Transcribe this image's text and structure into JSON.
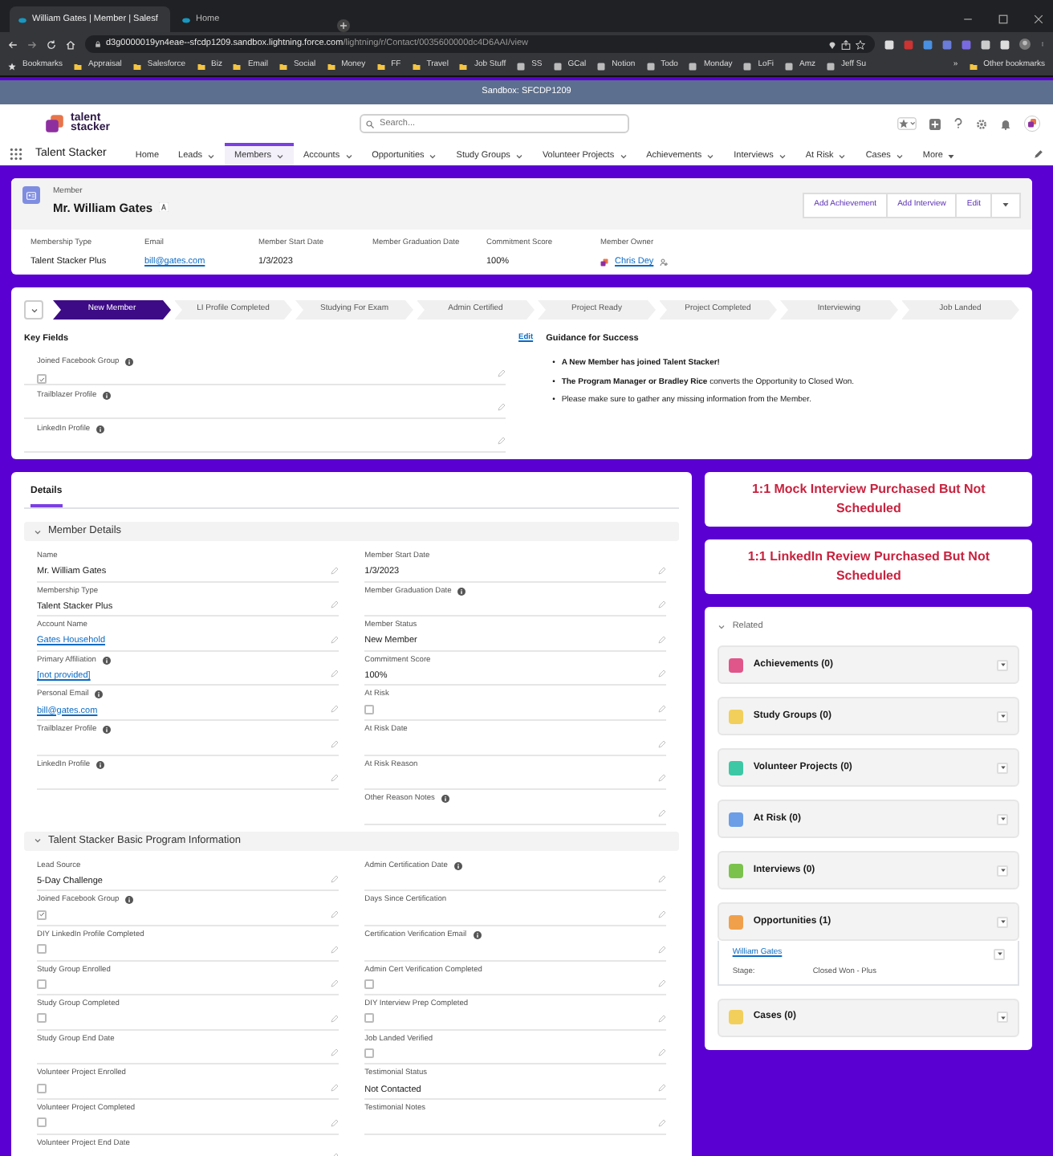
{
  "browser": {
    "tabs": [
      {
        "label": "William Gates | Member | Salesf",
        "selected": true
      },
      {
        "label": "Home",
        "selected": false
      }
    ],
    "url_host": "d3g0000019yn4eae--sfcdp1209.sandbox.lightning.force.com",
    "url_path": "/lightning/r/Contact/0035600000dc4D6AAI/view",
    "bookmarks": [
      {
        "label": "Bookmarks",
        "kind": "star"
      },
      {
        "label": "Appraisal",
        "kind": "folder"
      },
      {
        "label": "Salesforce",
        "kind": "folder"
      },
      {
        "label": "Biz",
        "kind": "folder"
      },
      {
        "label": "Email",
        "kind": "folder"
      },
      {
        "label": "Social",
        "kind": "folder"
      },
      {
        "label": "Money",
        "kind": "folder"
      },
      {
        "label": "FF",
        "kind": "folder"
      },
      {
        "label": "Travel",
        "kind": "folder"
      },
      {
        "label": "Job Stuff",
        "kind": "folder"
      },
      {
        "label": "SS",
        "kind": "site"
      },
      {
        "label": "GCal",
        "kind": "site"
      },
      {
        "label": "Notion",
        "kind": "site"
      },
      {
        "label": "Todo",
        "kind": "site"
      },
      {
        "label": "Monday",
        "kind": "site"
      },
      {
        "label": "LoFi",
        "kind": "site"
      },
      {
        "label": "Amz",
        "kind": "site"
      },
      {
        "label": "Jeff Su",
        "kind": "site"
      }
    ],
    "bookmarks_overflow": "»",
    "other_bookmarks": "Other bookmarks"
  },
  "sandbox_banner": "Sandbox: SFCDP1209",
  "header": {
    "logo_lines": [
      "talent",
      "stacker"
    ],
    "search_placeholder": "Search..."
  },
  "nav": {
    "app_name": "Talent Stacker",
    "items": [
      {
        "label": "Home",
        "dropdown": false,
        "selected": false
      },
      {
        "label": "Leads",
        "dropdown": true,
        "selected": false
      },
      {
        "label": "Members",
        "dropdown": true,
        "selected": true
      },
      {
        "label": "Accounts",
        "dropdown": true,
        "selected": false
      },
      {
        "label": "Opportunities",
        "dropdown": true,
        "selected": false
      },
      {
        "label": "Study Groups",
        "dropdown": true,
        "selected": false
      },
      {
        "label": "Volunteer Projects",
        "dropdown": true,
        "selected": false
      },
      {
        "label": "Achievements",
        "dropdown": true,
        "selected": false
      },
      {
        "label": "Interviews",
        "dropdown": true,
        "selected": false
      },
      {
        "label": "At Risk",
        "dropdown": true,
        "selected": false
      },
      {
        "label": "Cases",
        "dropdown": true,
        "selected": false
      }
    ],
    "more": "More"
  },
  "record": {
    "object": "Member",
    "name": "Mr. William Gates",
    "actions": [
      "Add Achievement",
      "Add Interview",
      "Edit"
    ],
    "highlights": [
      {
        "label": "Membership Type",
        "value": "Talent Stacker Plus",
        "kind": "text"
      },
      {
        "label": "Email",
        "value": "bill@gates.com",
        "kind": "link"
      },
      {
        "label": "Member Start Date",
        "value": "1/3/2023",
        "kind": "text"
      },
      {
        "label": "Member Graduation Date"
      },
      {
        "label": "Commitment Score",
        "value": "100%",
        "kind": "text"
      },
      {
        "label": "Member Owner",
        "value": "Chris Dey",
        "kind": "owner"
      }
    ]
  },
  "path": {
    "steps": [
      {
        "label": "New Member",
        "selected": true
      },
      {
        "label": "LI Profile Completed",
        "selected": false
      },
      {
        "label": "Studying For Exam",
        "selected": false
      },
      {
        "label": "Admin Certified",
        "selected": false
      },
      {
        "label": "Project Ready",
        "selected": false
      },
      {
        "label": "Project Completed",
        "selected": false
      },
      {
        "label": "Interviewing",
        "selected": false
      },
      {
        "label": "Job Landed",
        "selected": false
      }
    ],
    "key_fields_title": "Key Fields",
    "edit": "Edit",
    "key_fields": [
      {
        "label": "Joined Facebook Group",
        "kind": "checkbox",
        "checked": true,
        "info": true
      },
      {
        "label": "Trailblazer Profile",
        "info": true
      },
      {
        "label": "LinkedIn Profile",
        "info": true
      }
    ],
    "bullet": "•",
    "guidance_title": "Guidance for Success",
    "guidance": [
      "**A New Member has joined Talent Stacker!**",
      "**The Program Manager or Bradley Rice** converts the Opportunity to Closed Won.",
      "Please make sure to gather any missing information from the Member."
    ]
  },
  "details": {
    "tab": "Details",
    "sections": [
      {
        "title": "Member Details",
        "expanded": true,
        "left": [
          {
            "label": "Name",
            "value": "Mr. William Gates",
            "kind": "text"
          },
          {
            "label": "Membership Type",
            "value": "Talent Stacker Plus",
            "kind": "text"
          },
          {
            "label": "Account Name",
            "value": "Gates Household",
            "kind": "link"
          },
          {
            "label": "Primary Affiliation",
            "value": "[not provided]",
            "kind": "link",
            "info": true
          },
          {
            "label": "Personal Email",
            "value": "bill@gates.com",
            "kind": "link",
            "info": true
          },
          {
            "label": "Trailblazer Profile",
            "info": true
          },
          {
            "label": "LinkedIn Profile",
            "info": true
          }
        ],
        "right": [
          {
            "label": "Member Start Date",
            "value": "1/3/2023",
            "kind": "text"
          },
          {
            "label": "Member Graduation Date",
            "info": true
          },
          {
            "label": "Member Status",
            "value": "New Member",
            "kind": "text"
          },
          {
            "label": "Commitment Score",
            "value": "100%",
            "kind": "text"
          },
          {
            "label": "At Risk",
            "kind": "checkbox",
            "checked": false
          },
          {
            "label": "At Risk Date"
          },
          {
            "label": "At Risk Reason"
          },
          {
            "label": "Other Reason Notes",
            "info": true
          }
        ]
      },
      {
        "title": "Talent Stacker Basic Program Information",
        "expanded": true,
        "left": [
          {
            "label": "Lead Source",
            "value": "5-Day Challenge",
            "kind": "text"
          },
          {
            "label": "Joined Facebook Group",
            "kind": "checkbox",
            "checked": true,
            "info": true
          },
          {
            "label": "DIY LinkedIn Profile Completed",
            "kind": "checkbox",
            "checked": false
          },
          {
            "label": "Study Group Enrolled",
            "kind": "checkbox",
            "checked": false
          },
          {
            "label": "Study Group Completed",
            "kind": "checkbox",
            "checked": false
          },
          {
            "label": "Study Group End Date"
          },
          {
            "label": "Volunteer Project Enrolled",
            "kind": "checkbox",
            "checked": false
          },
          {
            "label": "Volunteer Project Completed",
            "kind": "checkbox",
            "checked": false
          },
          {
            "label": "Volunteer Project End Date"
          }
        ],
        "right": [
          {
            "label": "Admin Certification Date",
            "info": true
          },
          {
            "label": "Days Since Certification"
          },
          {
            "label": "Certification Verification Email",
            "info": true
          },
          {
            "label": "Admin Cert Verification Completed",
            "kind": "checkbox",
            "checked": false
          },
          {
            "label": "DIY Interview Prep Completed",
            "kind": "checkbox",
            "checked": false
          },
          {
            "label": "Job Landed Verified",
            "kind": "checkbox",
            "checked": false
          },
          {
            "label": "Testimonial Status",
            "value": "Not Contacted",
            "kind": "text"
          },
          {
            "label": "Testimonial Notes"
          }
        ]
      }
    ]
  },
  "alerts": [
    "1:1 Mock Interview Purchased But Not Scheduled",
    "1:1 LinkedIn Review Purchased But Not Scheduled"
  ],
  "related": {
    "title": "Related",
    "expanded": true,
    "lists": [
      {
        "label": "Achievements (0)",
        "color": "#e0568a"
      },
      {
        "label": "Study Groups (0)",
        "color": "#f2cf5b"
      },
      {
        "label": "Volunteer Projects (0)",
        "color": "#3cc8a5"
      },
      {
        "label": "At Risk (0)",
        "color": "#6b9ee6"
      },
      {
        "label": "Interviews (0)",
        "color": "#7bc24c"
      },
      {
        "label": "Opportunities (1)",
        "color": "#f0a04b",
        "records": [
          {
            "name": "William Gates",
            "stage_label": "Stage:",
            "stage": "Closed Won - Plus"
          }
        ]
      },
      {
        "label": "Cases (0)",
        "color": "#f2cf5b"
      }
    ]
  }
}
